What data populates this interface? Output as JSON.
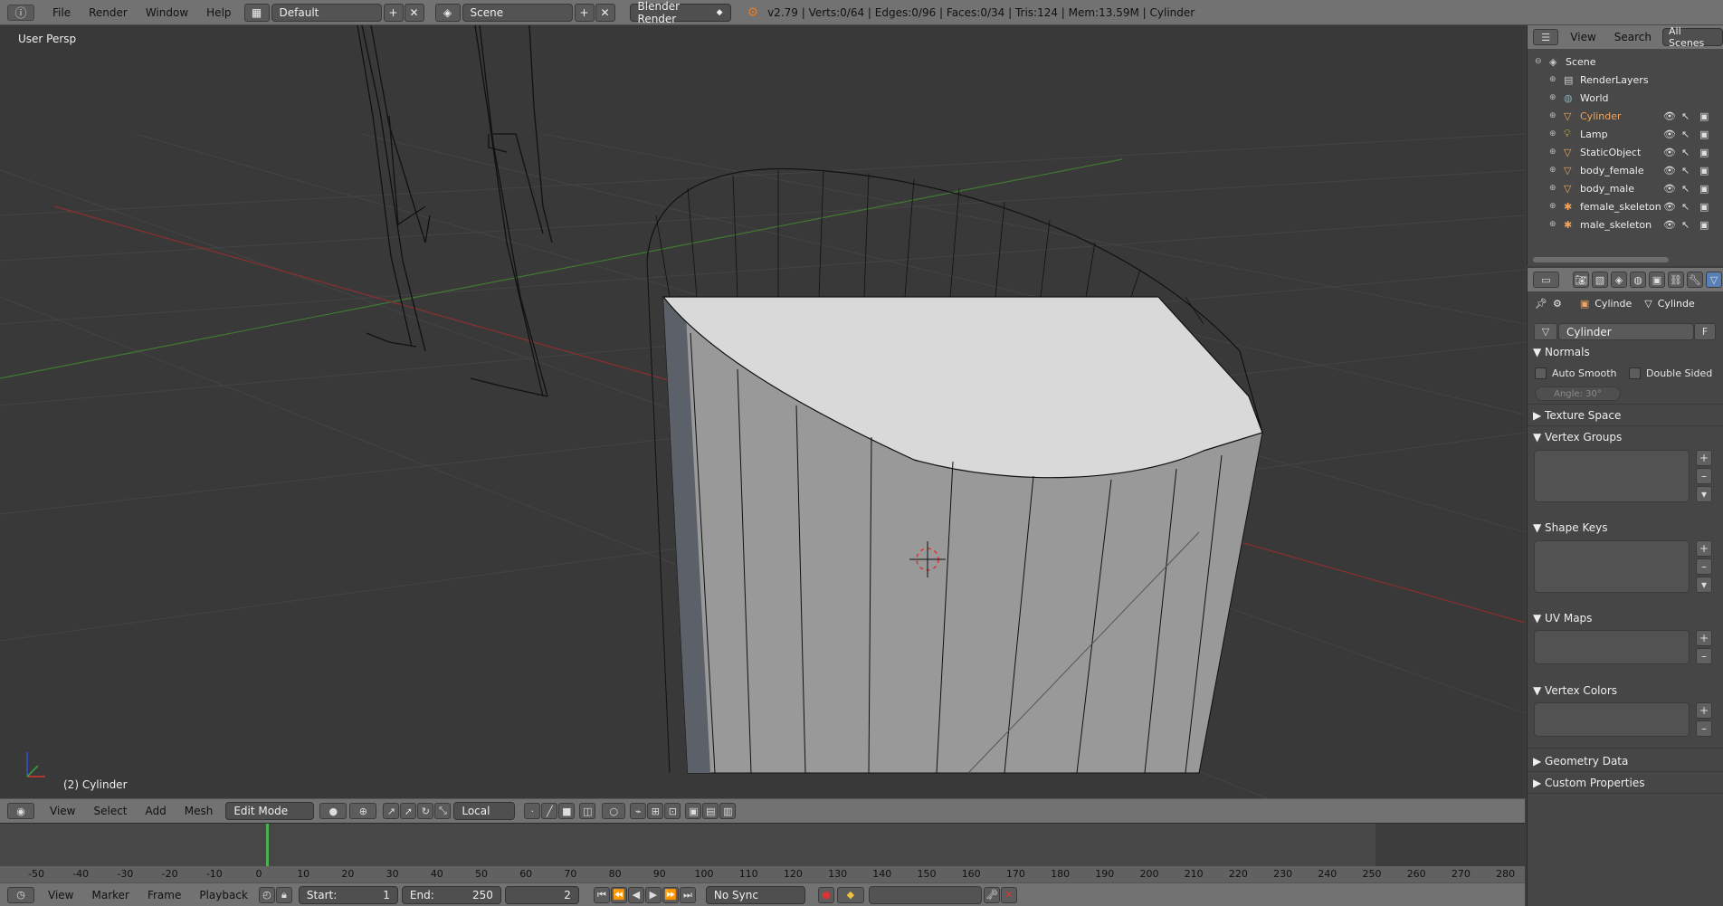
{
  "topbar": {
    "menu": [
      "File",
      "Render",
      "Window",
      "Help"
    ],
    "screen_layout": "Default",
    "scene": "Scene",
    "render_engine": "Blender Render",
    "stats": "v2.79 | Verts:0/64 | Edges:0/96 | Faces:0/34 | Tris:124 | Mem:13.59M | Cylinder"
  },
  "viewport": {
    "label": "User Persp",
    "object_info": "(2) Cylinder"
  },
  "view_header": {
    "menus": [
      "View",
      "Select",
      "Add",
      "Mesh"
    ],
    "mode": "Edit Mode",
    "orientation": "Local"
  },
  "timeline": {
    "ticks": [
      "-50",
      "-40",
      "-30",
      "-20",
      "-10",
      "0",
      "10",
      "20",
      "30",
      "40",
      "50",
      "60",
      "70",
      "80",
      "90",
      "100",
      "110",
      "120",
      "130",
      "140",
      "150",
      "160",
      "170",
      "180",
      "190",
      "200",
      "210",
      "220",
      "230",
      "240",
      "250",
      "260",
      "270",
      "280"
    ],
    "menus": [
      "View",
      "Marker",
      "Frame",
      "Playback"
    ],
    "start_label": "Start:",
    "start_value": "1",
    "end_label": "End:",
    "end_value": "250",
    "current_frame": "2",
    "sync": "No Sync"
  },
  "outliner": {
    "header": {
      "view": "View",
      "search": "Search",
      "filter": "All Scenes"
    },
    "items": [
      {
        "label": "Scene",
        "indent": 0,
        "icon": "scene-icon"
      },
      {
        "label": "RenderLayers",
        "indent": 1,
        "icon": "renderlayers-icon"
      },
      {
        "label": "World",
        "indent": 1,
        "icon": "world-icon"
      },
      {
        "label": "Cylinder",
        "indent": 1,
        "icon": "mesh-icon",
        "selected": true
      },
      {
        "label": "Lamp",
        "indent": 1,
        "icon": "lamp-icon"
      },
      {
        "label": "StaticObject",
        "indent": 1,
        "icon": "mesh-icon"
      },
      {
        "label": "body_female",
        "indent": 1,
        "icon": "mesh-icon"
      },
      {
        "label": "body_male",
        "indent": 1,
        "icon": "mesh-icon"
      },
      {
        "label": "female_skeleton",
        "indent": 1,
        "icon": "armature-icon"
      },
      {
        "label": "male_skeleton",
        "indent": 1,
        "icon": "armature-icon"
      }
    ]
  },
  "properties": {
    "breadcrumb": [
      "Cylinde",
      "Cylinde"
    ],
    "mesh_name": "Cylinder",
    "fake_user": "F",
    "normals": {
      "title": "Normals",
      "auto_smooth": "Auto Smooth",
      "double_sided": "Double Sided",
      "angle": "Angle:  30°"
    },
    "panels": {
      "texture_space": "Texture Space",
      "vertex_groups": "Vertex Groups",
      "shape_keys": "Shape Keys",
      "uv_maps": "UV Maps",
      "vertex_colors": "Vertex Colors",
      "geometry_data": "Geometry Data",
      "custom_properties": "Custom Properties"
    }
  },
  "colors": {
    "accent_selected": "#f0a35a",
    "header": "#727272",
    "viewport_bg": "#393939"
  }
}
